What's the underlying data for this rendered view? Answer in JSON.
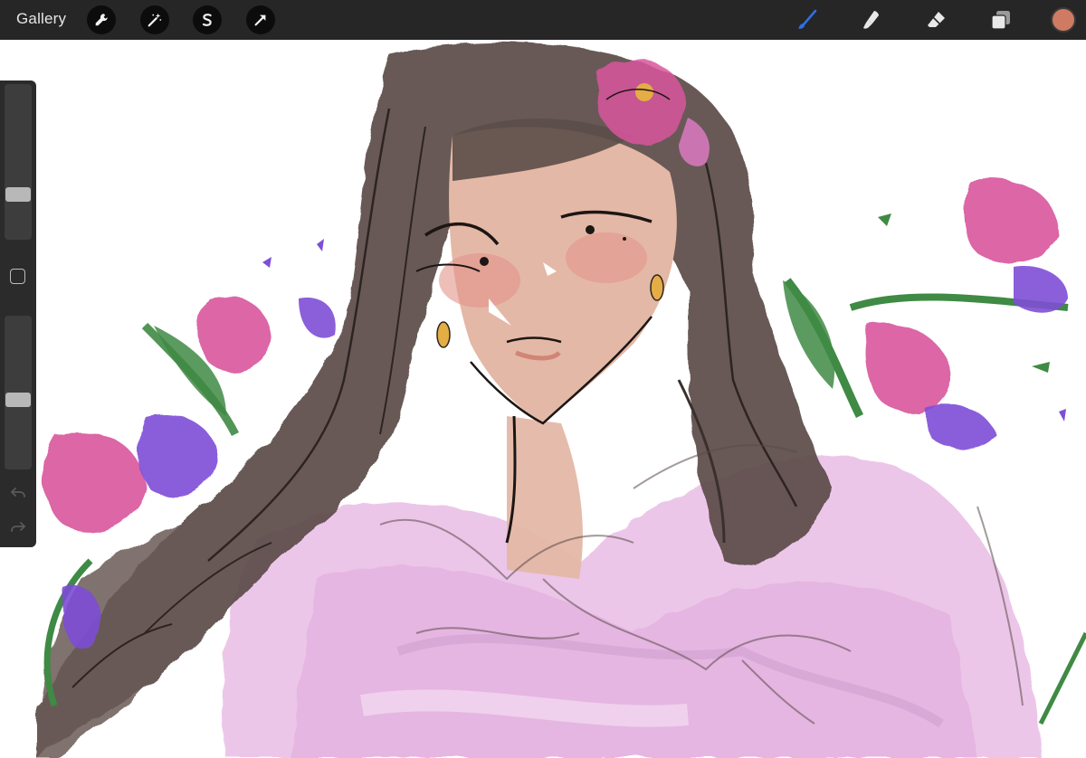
{
  "toolbar": {
    "gallery_label": "Gallery",
    "left_tools": [
      {
        "name": "actions",
        "icon": "wrench-icon"
      },
      {
        "name": "adjustments",
        "icon": "magic-wand-icon"
      },
      {
        "name": "selection",
        "icon": "selection-s-icon"
      },
      {
        "name": "transform",
        "icon": "arrow-cursor-icon"
      }
    ],
    "right_tools": [
      {
        "name": "brush",
        "icon": "brush-icon",
        "active": true
      },
      {
        "name": "smudge",
        "icon": "smudge-icon",
        "active": false
      },
      {
        "name": "eraser",
        "icon": "eraser-icon",
        "active": false
      },
      {
        "name": "layers",
        "icon": "layers-icon",
        "active": false
      }
    ],
    "active_color": "#cf7a63",
    "active_tool_color": "#2f6fe4"
  },
  "sidebar": {
    "brush_size_level": 0.27,
    "opacity_level": 0.45,
    "modify_button": "modify-square-icon",
    "undo": "undo-icon",
    "redo": "redo-icon"
  },
  "canvas": {
    "palette": {
      "hair": "#5b4c49",
      "skin": "#e4b8a6",
      "blush": "#e2928a",
      "dress": "#e3aee0",
      "flower_pink": "#d9579d",
      "flower_purple": "#7e4ed6",
      "leaf": "#3f8a44",
      "line": "#1c1614",
      "earring": "#e4ad45"
    }
  }
}
